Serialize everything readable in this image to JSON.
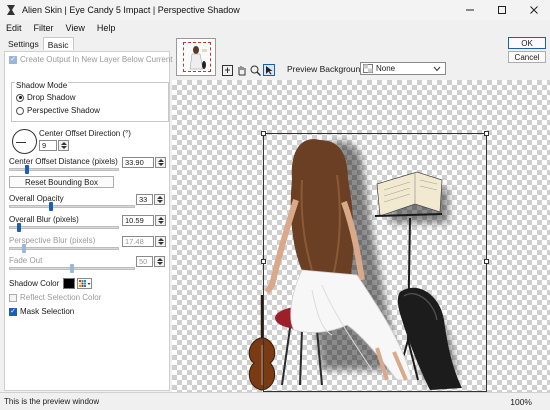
{
  "window": {
    "title": "Alien Skin | Eye Candy 5 Impact | Perspective Shadow",
    "controls": [
      "minimize",
      "maximize",
      "close"
    ]
  },
  "menu": [
    "Edit",
    "Filter",
    "View",
    "Help"
  ],
  "tabs": [
    {
      "label": "Settings",
      "active": false
    },
    {
      "label": "Basic",
      "active": true
    }
  ],
  "basic": {
    "create_output": {
      "label": "Create Output In New Layer Below Current",
      "checked": true,
      "enabled": false
    },
    "shadow_mode": {
      "title": "Shadow Mode",
      "options": [
        {
          "label": "Drop Shadow",
          "selected": true
        },
        {
          "label": "Perspective Shadow",
          "selected": false
        }
      ]
    },
    "center_offset_direction": {
      "label": "Center Offset Direction (°)",
      "value": "9"
    },
    "center_offset_distance": {
      "label": "Center Offset Distance (pixels)",
      "value": "33.90",
      "level": 0.15
    },
    "reset_bounding_box": "Reset Bounding Box",
    "overall_opacity": {
      "label": "Overall Opacity",
      "value": "33",
      "level": 0.33
    },
    "overall_blur": {
      "label": "Overall Blur (pixels)",
      "value": "10.59",
      "level": 0.08
    },
    "perspective_blur": {
      "label": "Perspective Blur (pixels)",
      "value": "17.48",
      "level": 0.12,
      "enabled": false
    },
    "fade_out": {
      "label": "Fade Out",
      "value": "50",
      "level": 0.5,
      "enabled": false
    },
    "shadow_color": {
      "label": "Shadow Color",
      "color": "#000000"
    },
    "reflect_selection_color": {
      "label": "Reflect Selection Color",
      "checked": false,
      "enabled": false
    },
    "mask_selection": {
      "label": "Mask Selection",
      "checked": true
    }
  },
  "buttons": {
    "ok": "OK",
    "cancel": "Cancel"
  },
  "toolbar": {
    "preview_background_label": "Preview Background:",
    "preview_background_value": "None",
    "tools": [
      "navigator-icon",
      "hand-icon",
      "zoom-icon",
      "select-icon"
    ]
  },
  "status": {
    "text": "This is the preview window",
    "zoom": "100%"
  },
  "colors": {
    "accent": "#1a5fb4",
    "checker_dark": "#cfcfcf",
    "checker_light": "#ffffff"
  }
}
